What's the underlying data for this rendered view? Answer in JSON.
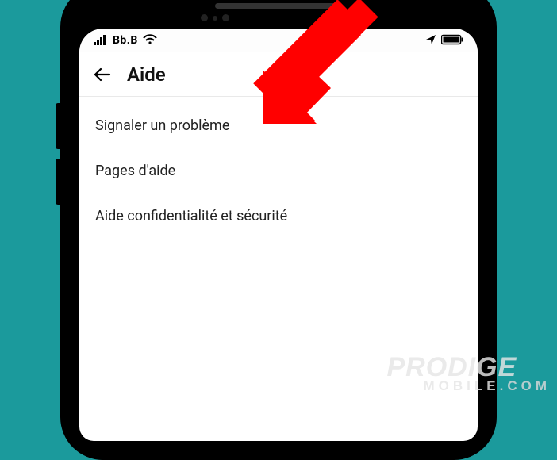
{
  "statusbar": {
    "carrier": "Bb.B"
  },
  "appbar": {
    "title": "Aide"
  },
  "menu": {
    "items": [
      {
        "label": "Signaler un problème"
      },
      {
        "label": "Pages d'aide"
      },
      {
        "label": "Aide confidentialité et sécurité"
      }
    ]
  },
  "watermark": {
    "line1": "PRODIGE",
    "line2a": "MOBILE",
    "line2b": ".COM"
  },
  "colors": {
    "background": "#1b9a9c",
    "arrow": "#ff0000"
  }
}
